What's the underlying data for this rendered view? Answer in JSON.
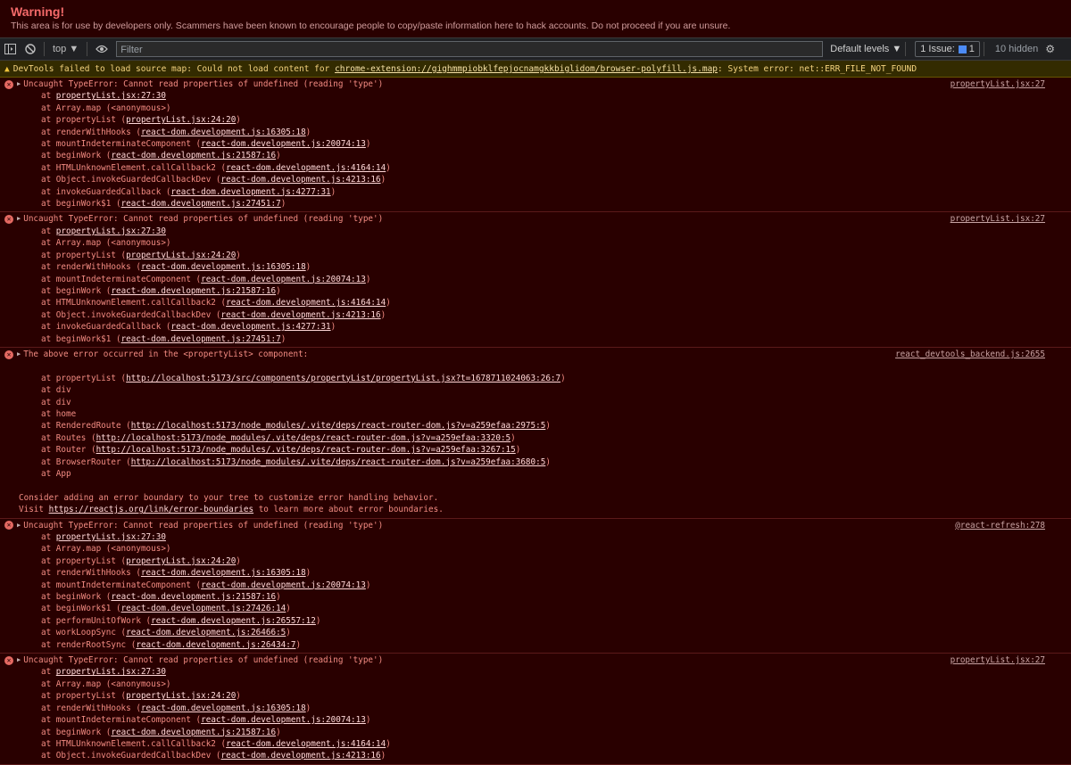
{
  "warning": {
    "title": "Warning!",
    "text": "This area is for use by developers only. Scammers have been known to encourage people to copy/paste information here to hack accounts. Do not proceed if you are unsure."
  },
  "toolbar": {
    "sidebar_icon": "sidebar-toggle-icon",
    "clear_icon": "block-icon",
    "context": "top ▼",
    "eye_icon": "eye-icon",
    "filter_placeholder": "Filter",
    "levels": "Default levels ▼",
    "issues_prefix": "1 Issue:",
    "issues_count": "1",
    "hidden": "10 hidden",
    "settings_icon": "gear-icon"
  },
  "colors": {
    "background": "#290000",
    "error_text": "#f28b82",
    "warning_title": "#f46a6a",
    "warning_bar": "#332b00"
  },
  "source_map_warning": {
    "prefix": "DevTools failed to load source map: Could not load content for ",
    "link": "chrome-extension://gighmmpiobklfepjocnamgkkbiglidom/browser-polyfill.js.map",
    "suffix": ": System error: net::ERR_FILE_NOT_FOUND"
  },
  "messages": [
    {
      "text": "Uncaught TypeError: Cannot read properties of undefined (reading 'type')",
      "source": "propertyList.jsx:27",
      "frames": [
        {
          "pre": "at ",
          "link": "propertyList.jsx:27:30"
        },
        {
          "pre": "at Array.map (<anonymous>)"
        },
        {
          "pre": "at propertyList (",
          "link": "propertyList.jsx:24:20",
          "post": ")"
        },
        {
          "pre": "at renderWithHooks (",
          "link": "react-dom.development.js:16305:18",
          "post": ")"
        },
        {
          "pre": "at mountIndeterminateComponent (",
          "link": "react-dom.development.js:20074:13",
          "post": ")"
        },
        {
          "pre": "at beginWork (",
          "link": "react-dom.development.js:21587:16",
          "post": ")"
        },
        {
          "pre": "at HTMLUnknownElement.callCallback2 (",
          "link": "react-dom.development.js:4164:14",
          "post": ")"
        },
        {
          "pre": "at Object.invokeGuardedCallbackDev (",
          "link": "react-dom.development.js:4213:16",
          "post": ")"
        },
        {
          "pre": "at invokeGuardedCallback (",
          "link": "react-dom.development.js:4277:31",
          "post": ")"
        },
        {
          "pre": "at beginWork$1 (",
          "link": "react-dom.development.js:27451:7",
          "post": ")"
        }
      ]
    },
    {
      "text": "Uncaught TypeError: Cannot read properties of undefined (reading 'type')",
      "source": "propertyList.jsx:27",
      "frames": [
        {
          "pre": "at ",
          "link": "propertyList.jsx:27:30"
        },
        {
          "pre": "at Array.map (<anonymous>)"
        },
        {
          "pre": "at propertyList (",
          "link": "propertyList.jsx:24:20",
          "post": ")"
        },
        {
          "pre": "at renderWithHooks (",
          "link": "react-dom.development.js:16305:18",
          "post": ")"
        },
        {
          "pre": "at mountIndeterminateComponent (",
          "link": "react-dom.development.js:20074:13",
          "post": ")"
        },
        {
          "pre": "at beginWork (",
          "link": "react-dom.development.js:21587:16",
          "post": ")"
        },
        {
          "pre": "at HTMLUnknownElement.callCallback2 (",
          "link": "react-dom.development.js:4164:14",
          "post": ")"
        },
        {
          "pre": "at Object.invokeGuardedCallbackDev (",
          "link": "react-dom.development.js:4213:16",
          "post": ")"
        },
        {
          "pre": "at invokeGuardedCallback (",
          "link": "react-dom.development.js:4277:31",
          "post": ")"
        },
        {
          "pre": "at beginWork$1 (",
          "link": "react-dom.development.js:27451:7",
          "post": ")"
        }
      ]
    },
    {
      "text": "The above error occurred in the <propertyList> component:",
      "source": "react_devtools_backend.js:2655",
      "component_stack": true,
      "frames": [
        {
          "pre": "at propertyList (",
          "link": "http://localhost:5173/src/components/propertyList/propertyList.jsx?t=1678711024063:26:7",
          "post": ")"
        },
        {
          "pre": "at div"
        },
        {
          "pre": "at div"
        },
        {
          "pre": "at home"
        },
        {
          "pre": "at RenderedRoute (",
          "link": "http://localhost:5173/node_modules/.vite/deps/react-router-dom.js?v=a259efaa:2975:5",
          "post": ")"
        },
        {
          "pre": "at Routes (",
          "link": "http://localhost:5173/node_modules/.vite/deps/react-router-dom.js?v=a259efaa:3320:5",
          "post": ")"
        },
        {
          "pre": "at Router (",
          "link": "http://localhost:5173/node_modules/.vite/deps/react-router-dom.js?v=a259efaa:3267:15",
          "post": ")"
        },
        {
          "pre": "at BrowserRouter (",
          "link": "http://localhost:5173/node_modules/.vite/deps/react-router-dom.js?v=a259efaa:3680:5",
          "post": ")"
        },
        {
          "pre": "at App"
        }
      ],
      "footer": [
        {
          "pre": "Consider adding an error boundary to your tree to customize error handling behavior."
        },
        {
          "pre": "Visit ",
          "link": "https://reactjs.org/link/error-boundaries",
          "post": " to learn more about error boundaries."
        }
      ]
    },
    {
      "text": "Uncaught TypeError: Cannot read properties of undefined (reading 'type')",
      "source": "@react-refresh:278",
      "frames": [
        {
          "pre": "at ",
          "link": "propertyList.jsx:27:30"
        },
        {
          "pre": "at Array.map (<anonymous>)"
        },
        {
          "pre": "at propertyList (",
          "link": "propertyList.jsx:24:20",
          "post": ")"
        },
        {
          "pre": "at renderWithHooks (",
          "link": "react-dom.development.js:16305:18",
          "post": ")"
        },
        {
          "pre": "at mountIndeterminateComponent (",
          "link": "react-dom.development.js:20074:13",
          "post": ")"
        },
        {
          "pre": "at beginWork (",
          "link": "react-dom.development.js:21587:16",
          "post": ")"
        },
        {
          "pre": "at beginWork$1 (",
          "link": "react-dom.development.js:27426:14",
          "post": ")"
        },
        {
          "pre": "at performUnitOfWork (",
          "link": "react-dom.development.js:26557:12",
          "post": ")"
        },
        {
          "pre": "at workLoopSync (",
          "link": "react-dom.development.js:26466:5",
          "post": ")"
        },
        {
          "pre": "at renderRootSync (",
          "link": "react-dom.development.js:26434:7",
          "post": ")"
        }
      ]
    },
    {
      "text": "Uncaught TypeError: Cannot read properties of undefined (reading 'type')",
      "source": "propertyList.jsx:27",
      "frames": [
        {
          "pre": "at ",
          "link": "propertyList.jsx:27:30"
        },
        {
          "pre": "at Array.map (<anonymous>)"
        },
        {
          "pre": "at propertyList (",
          "link": "propertyList.jsx:24:20",
          "post": ")"
        },
        {
          "pre": "at renderWithHooks (",
          "link": "react-dom.development.js:16305:18",
          "post": ")"
        },
        {
          "pre": "at mountIndeterminateComponent (",
          "link": "react-dom.development.js:20074:13",
          "post": ")"
        },
        {
          "pre": "at beginWork (",
          "link": "react-dom.development.js:21587:16",
          "post": ")"
        },
        {
          "pre": "at HTMLUnknownElement.callCallback2 (",
          "link": "react-dom.development.js:4164:14",
          "post": ")"
        },
        {
          "pre": "at Object.invokeGuardedCallbackDev (",
          "link": "react-dom.development.js:4213:16",
          "post": ")"
        }
      ]
    }
  ]
}
